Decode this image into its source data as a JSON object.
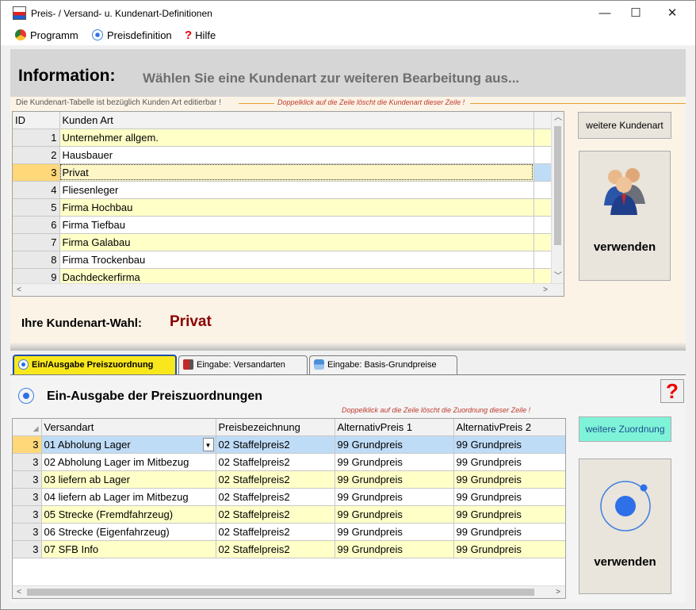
{
  "window": {
    "title": "Preis- / Versand- u. Kundenart-Definitionen",
    "minimize": "—",
    "maximize": "☐",
    "close": "✕"
  },
  "menu": {
    "items": [
      "Programm",
      "Preisdefinition",
      "Hilfe"
    ]
  },
  "info": {
    "label": "Information:",
    "text": "Wählen Sie eine Kundenart zur weiteren Bearbeitung aus..."
  },
  "kundenart": {
    "note_left": "Die Kundenart-Tabelle ist bezüglich Kunden Art editierbar !",
    "note_right": "Doppelklick auf die Zeile löscht die Kundenart dieser Zeile !",
    "columns": [
      "ID",
      "Kunden Art"
    ],
    "rows": [
      {
        "id": "1",
        "name": "Unternehmer allgem."
      },
      {
        "id": "2",
        "name": "Hausbauer"
      },
      {
        "id": "3",
        "name": "Privat"
      },
      {
        "id": "4",
        "name": "Fliesenleger"
      },
      {
        "id": "5",
        "name": "Firma Hochbau"
      },
      {
        "id": "6",
        "name": "Firma Tiefbau"
      },
      {
        "id": "7",
        "name": "Firma Galabau"
      },
      {
        "id": "8",
        "name": "Firma Trockenbau"
      },
      {
        "id": "9",
        "name": "Dachdeckerfirma"
      }
    ],
    "selected_index": 2,
    "add_button": "weitere Kundenart",
    "use_button": "verwenden"
  },
  "wahl": {
    "label": "Ihre Kundenart-Wahl:",
    "value": "Privat"
  },
  "tabs": [
    {
      "label": "Ein/Ausgabe Preiszuordnung",
      "active": true
    },
    {
      "label": "Eingabe:  Versandarten",
      "active": false
    },
    {
      "label": "Eingabe: Basis-Grundpreise",
      "active": false
    }
  ],
  "zuordnung": {
    "title": "Ein-Ausgabe der Preiszuordnungen",
    "note": "Doppelklick auf die Zeile löscht die Zuordnung dieser Zeile !",
    "columns": [
      "Versandart",
      "Preisbezeichnung",
      "AlternativPreis 1",
      "AlternativPreis 2"
    ],
    "rows": [
      {
        "id": "3",
        "versandart": "01 Abholung Lager",
        "preis": "02 Staffelpreis2",
        "alt1": "99 Grundpreis",
        "alt2": "99 Grundpreis"
      },
      {
        "id": "3",
        "versandart": "02 Abholung Lager im Mitbezug",
        "preis": "02 Staffelpreis2",
        "alt1": "99 Grundpreis",
        "alt2": "99 Grundpreis"
      },
      {
        "id": "3",
        "versandart": "03 liefern ab Lager",
        "preis": "02 Staffelpreis2",
        "alt1": "99 Grundpreis",
        "alt2": "99 Grundpreis"
      },
      {
        "id": "3",
        "versandart": "04 liefern ab Lager im Mitbezug",
        "preis": "02 Staffelpreis2",
        "alt1": "99 Grundpreis",
        "alt2": "99 Grundpreis"
      },
      {
        "id": "3",
        "versandart": "05 Strecke (Fremdfahrzeug)",
        "preis": "02 Staffelpreis2",
        "alt1": "99 Grundpreis",
        "alt2": "99 Grundpreis"
      },
      {
        "id": "3",
        "versandart": "06 Strecke (Eigenfahrzeug)",
        "preis": "02 Staffelpreis2",
        "alt1": "99 Grundpreis",
        "alt2": "99 Grundpreis"
      },
      {
        "id": "3",
        "versandart": "07 SFB Info",
        "preis": "02 Staffelpreis2",
        "alt1": "99 Grundpreis",
        "alt2": "99 Grundpreis"
      }
    ],
    "add_button": "weitere Zuordnung",
    "use_button": "verwenden",
    "help_glyph": "?"
  },
  "colors": {
    "accent_yellow": "#f8e71c",
    "row_yellow": "#ffffc8",
    "selection_blue": "#bfdcf7",
    "wahl_red": "#8b0000",
    "add_zuordnung_bg": "#7ff3d8"
  },
  "icons": {
    "users": "users-icon",
    "orbit": "orbit-icon",
    "help": "help-icon"
  }
}
